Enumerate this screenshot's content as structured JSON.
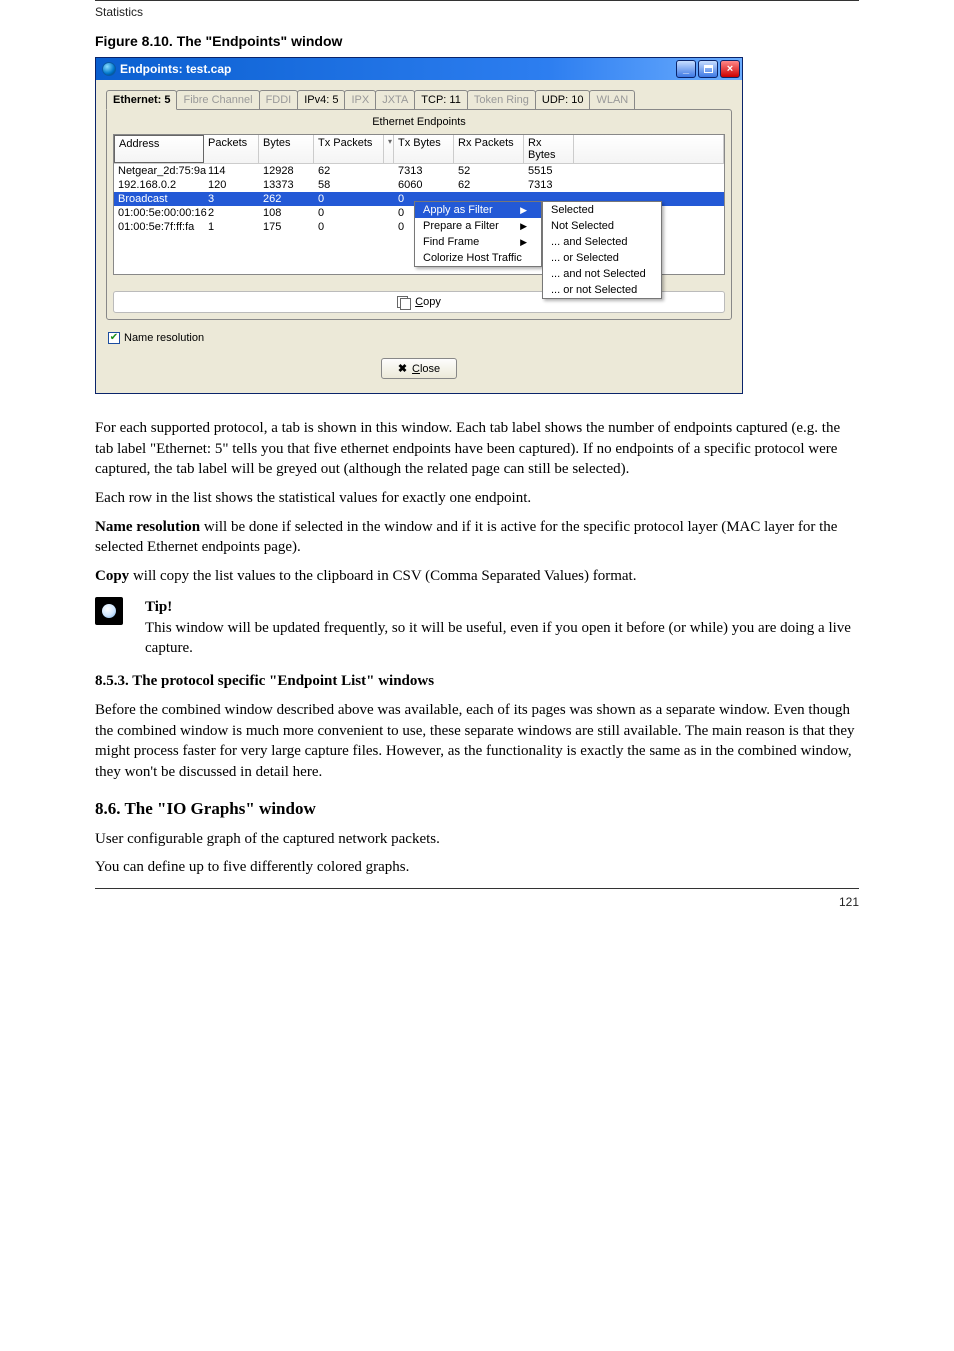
{
  "header": {
    "left": "Statistics",
    "right": ""
  },
  "figure_caption": "Figure 8.10. The \"Endpoints\" window",
  "window": {
    "title": "Endpoints: test.cap",
    "buttons": {
      "min": "_",
      "max": "▢",
      "close": "×"
    },
    "tabs": [
      {
        "label": "Ethernet: 5",
        "enabled": true,
        "active": true
      },
      {
        "label": "Fibre Channel",
        "enabled": false
      },
      {
        "label": "FDDI",
        "enabled": false
      },
      {
        "label": "IPv4: 5",
        "enabled": true
      },
      {
        "label": "IPX",
        "enabled": false
      },
      {
        "label": "JXTA",
        "enabled": false
      },
      {
        "label": "TCP: 11",
        "enabled": true
      },
      {
        "label": "Token Ring",
        "enabled": false
      },
      {
        "label": "UDP: 10",
        "enabled": true
      },
      {
        "label": "WLAN",
        "enabled": false
      }
    ],
    "panel_title": "Ethernet Endpoints",
    "columns": [
      "Address",
      "Packets",
      "Bytes",
      "Tx Packets",
      "",
      "Tx Bytes",
      "Rx Packets",
      "Rx Bytes",
      ""
    ],
    "rows": [
      {
        "cells": [
          "Netgear_2d:75:9a",
          "114",
          "12928",
          "62",
          "",
          "7313",
          "52",
          "5515",
          ""
        ]
      },
      {
        "cells": [
          "192.168.0.2",
          "120",
          "13373",
          "58",
          "",
          "6060",
          "62",
          "7313",
          ""
        ]
      },
      {
        "cells": [
          "Broadcast",
          "3",
          "262",
          "0",
          "",
          "0",
          "",
          "",
          ""
        ],
        "selected": true
      },
      {
        "cells": [
          "01:00:5e:00:00:16",
          "2",
          "108",
          "0",
          "",
          "0",
          "",
          "",
          ""
        ]
      },
      {
        "cells": [
          "01:00:5e:7f:ff:fa",
          "1",
          "175",
          "0",
          "",
          "0",
          "",
          "",
          ""
        ]
      }
    ],
    "context_menu": {
      "primary": [
        {
          "label": "Apply as Filter",
          "sub": true,
          "selected": true
        },
        {
          "label": "Prepare a Filter",
          "sub": true
        },
        {
          "label": "Find Frame",
          "sub": true
        },
        {
          "label": "Colorize Host Traffic"
        }
      ],
      "secondary": [
        "Selected",
        "Not Selected",
        "... and Selected",
        "... or Selected",
        "... and not Selected",
        "... or not Selected"
      ]
    },
    "copy_label": "Copy",
    "name_resolution_label": "Name resolution",
    "close_label": "Close"
  },
  "para1": "For each supported protocol, a tab is shown in this window. Each tab label shows the number of endpoints captured (e.g. the tab label \"Ethernet: 5\" tells you that five ethernet endpoints have been captured). If no endpoints of a specific protocol were captured, the tab label will be greyed out (although the related page can still be selected).",
  "para2": "Each row in the list shows the statistical values for exactly one endpoint.",
  "para3_a": "Name resolution",
  "para3_b": " will be done if selected in the window and if it is active for the specific protocol layer (MAC layer for the selected Ethernet endpoints page).",
  "para4": "Copy",
  "para4_b": " will copy the list values to the clipboard in CSV (Comma Separated Values) format.",
  "tip_title": "Tip!",
  "tip_body": "This window will be updated frequently, so it will be useful, even if you open it before (or while) you are doing a live capture.",
  "section": {
    "num": "8.5.3. ",
    "title": "The protocol specific \"Endpoint List\" windows",
    "p1": "Before the combined window described above was available, each of its pages was shown as a separate window. Even though the combined window is much more convenient to use, these separate windows are still available. The main reason is that they might process faster for very large capture files. However, as the functionality is exactly the same as in the combined window, they won't be discussed in detail here."
  },
  "iograph": {
    "heading": "8.6. The \"IO Graphs\" window",
    "p1": "User configurable graph of the captured network packets.",
    "p2": "You can define up to five differently colored graphs."
  },
  "footer": {
    "left": "",
    "right": "121"
  }
}
